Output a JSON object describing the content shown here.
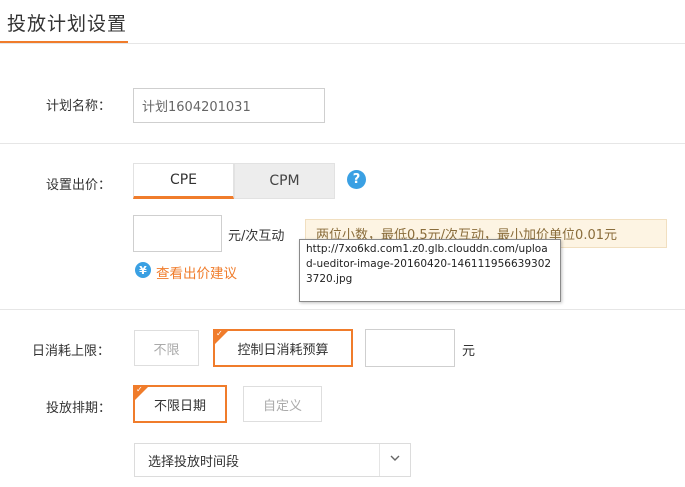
{
  "header": {
    "title": "投放计划设置"
  },
  "plan_name": {
    "label": "计划名称：",
    "value": "计划1604201031"
  },
  "bid": {
    "label": "设置出价：",
    "tabs": [
      {
        "label": "CPE",
        "active": true
      },
      {
        "label": "CPM",
        "active": false
      }
    ],
    "help_glyph": "?",
    "input_value": "",
    "unit": "元/次互动",
    "hint": "两位小数，最低0.5元/次互动，最小加价单位0.01元",
    "tooltip": "http://7xo6kd.com1.z0.glb.clouddn.com/upload-ueditor-image-20160420-1461119566393023720.jpg",
    "advice_icon_glyph": "¥",
    "advice_link": "查看出价建议"
  },
  "daily_limit": {
    "label": "日消耗上限：",
    "options": [
      {
        "label": "不限",
        "selected": false
      },
      {
        "label": "控制日消耗预算",
        "selected": true
      }
    ],
    "input_value": "",
    "unit": "元"
  },
  "schedule": {
    "label": "投放排期：",
    "options": [
      {
        "label": "不限日期",
        "selected": true
      },
      {
        "label": "自定义",
        "selected": false
      }
    ],
    "time_select": "选择投放时间段"
  },
  "colors": {
    "accent": "#f07c2b",
    "info_blue": "#3aa0e3",
    "hint_bg": "#fdf4e3"
  },
  "icons": {
    "help": "question-circle-icon",
    "advice": "yen-circle-icon",
    "select": "chevron-down-icon",
    "selected_marker": "check-corner-icon"
  }
}
